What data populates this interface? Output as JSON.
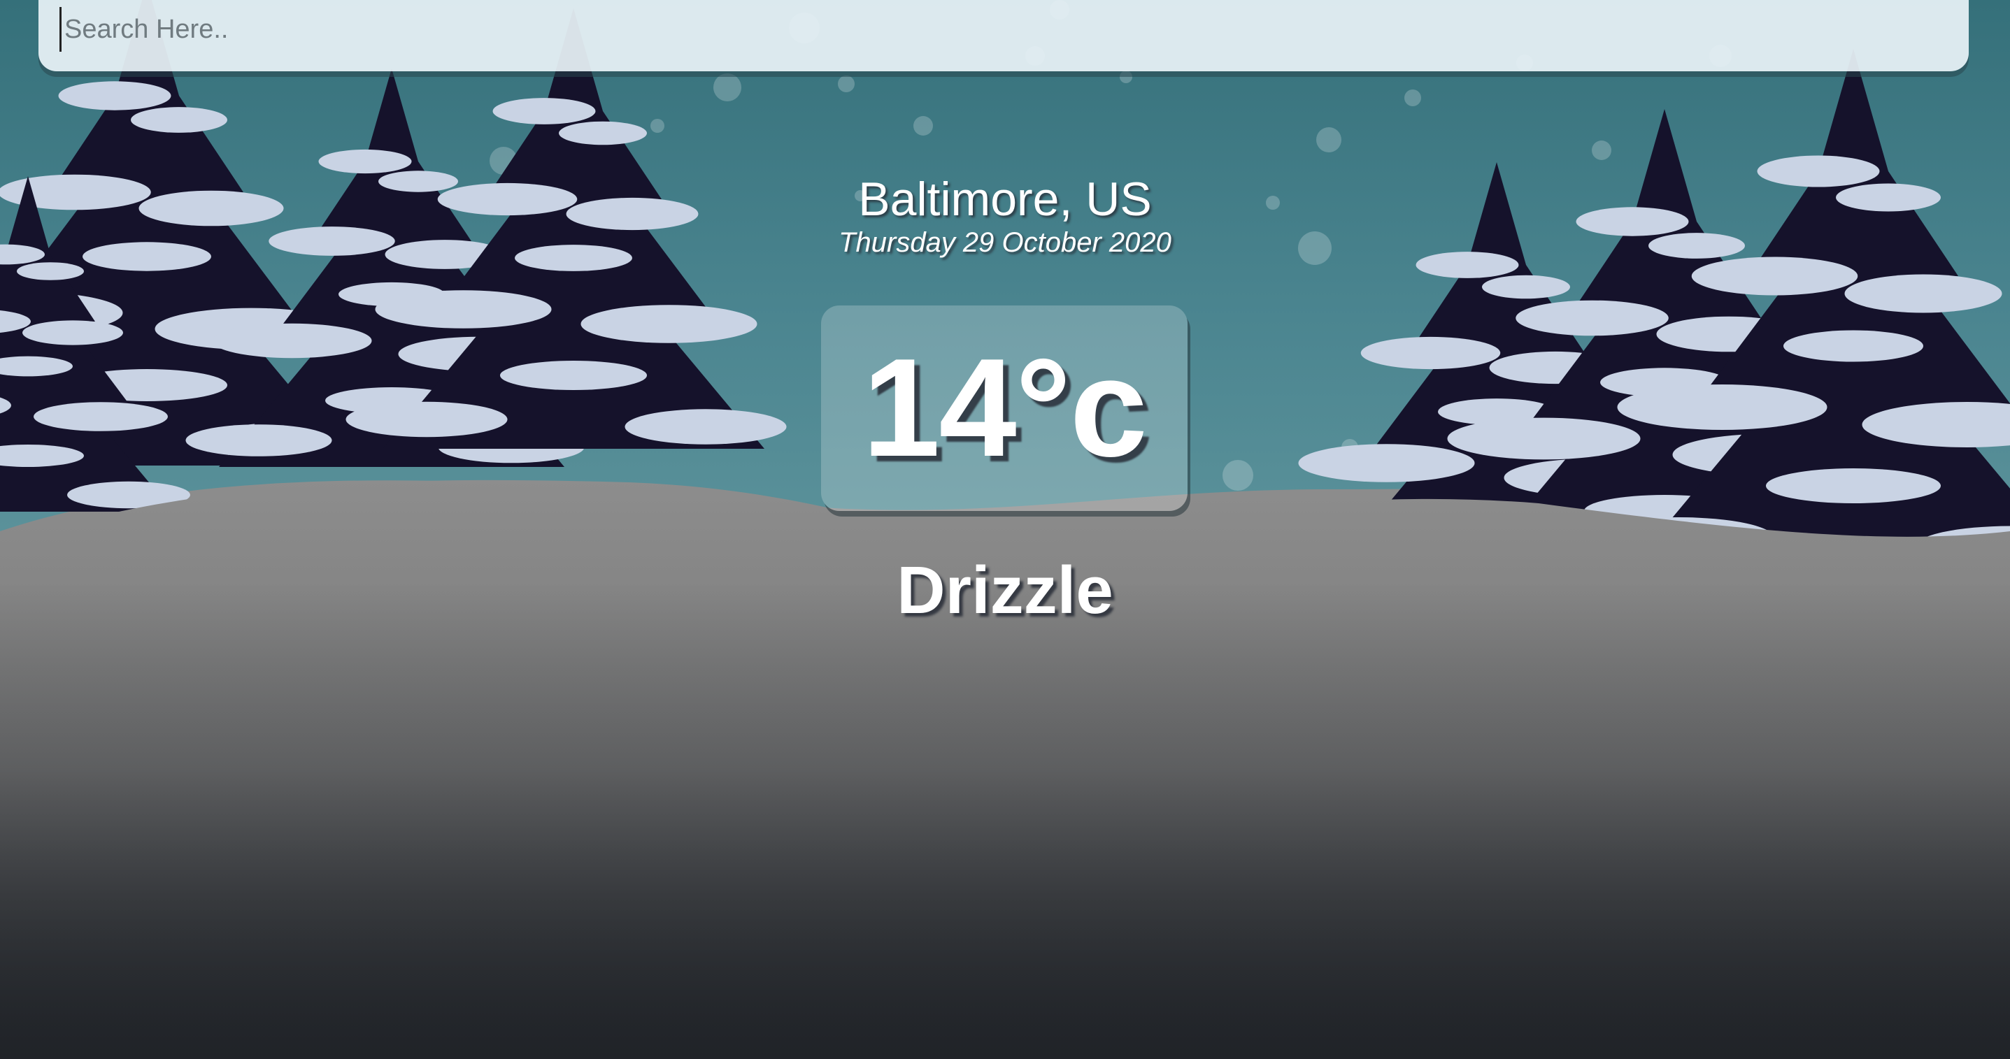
{
  "search": {
    "placeholder": "Search Here..",
    "value": ""
  },
  "weather": {
    "location": "Baltimore, US",
    "date": "Thursday 29 October 2020",
    "temperature": "14°c",
    "condition": "Drizzle"
  },
  "background": {
    "theme": "snowy-pine-forest",
    "sky_color": "#4b8590",
    "tree_color": "#15122b",
    "snow_color": "#c9d3e4",
    "ground_color": "#8a8a8a"
  }
}
